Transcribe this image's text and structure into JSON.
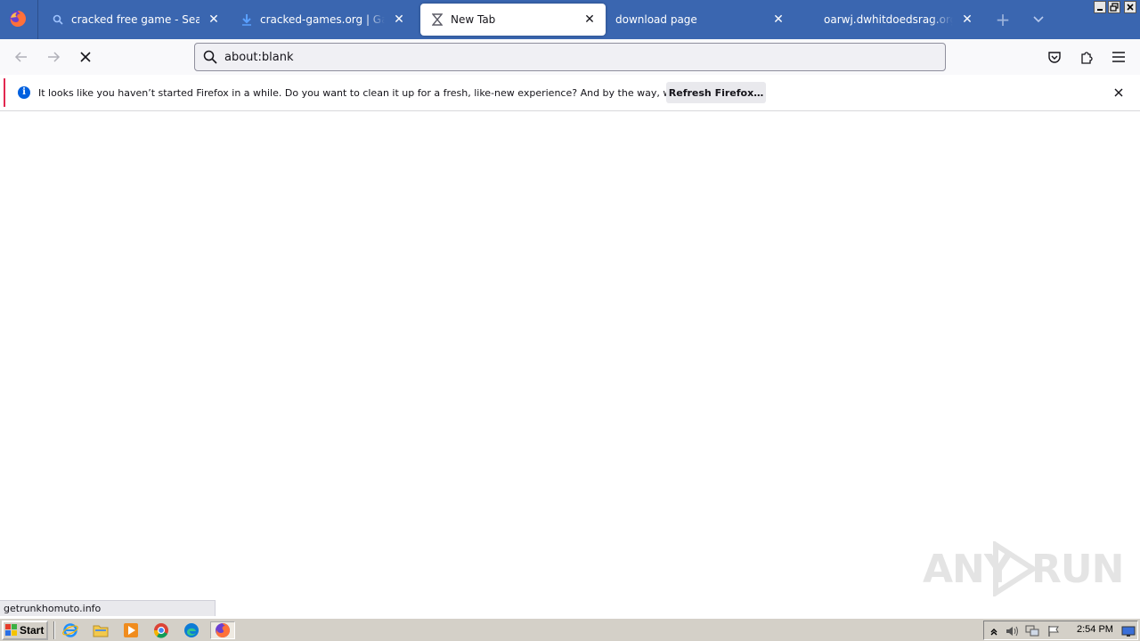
{
  "browser": {
    "tabs": [
      {
        "title": "cracked free game - Search",
        "icon": "search-icon"
      },
      {
        "title": "cracked-games.org | Games & Software",
        "icon": "download-arrow-icon"
      },
      {
        "title": "New Tab",
        "icon": "hourglass-loading-icon",
        "active": true
      },
      {
        "title": "download page",
        "icon": ""
      },
      {
        "title": "oarwj.dwhitdoedsrag.org/TIF?t=",
        "icon": ""
      }
    ],
    "close_glyph": "✕",
    "newtab_glyph": "+",
    "urlbar": {
      "value": "about:blank"
    }
  },
  "notification": {
    "message": "It looks like you haven’t started Firefox in a while. Do you want to clean it up for a fresh, like-new experience? And by the way, welcome back!",
    "button_label": "Refresh Firefox…",
    "info_glyph": "i"
  },
  "status_bar": {
    "text": "getrunkhomuto.info"
  },
  "watermark": {
    "left_text": "ANY",
    "right_text": "RUN"
  },
  "taskbar": {
    "start_label": "Start",
    "clock": "2:54 PM",
    "pinned": [
      "ie-icon",
      "explorer-folder-icon",
      "media-player-icon",
      "chrome-icon",
      "edge-icon",
      "firefox-icon"
    ]
  },
  "colors": {
    "tabbar_bg": "#3a66b0",
    "accent": "#0060df",
    "notification_edge": "#e22850"
  }
}
